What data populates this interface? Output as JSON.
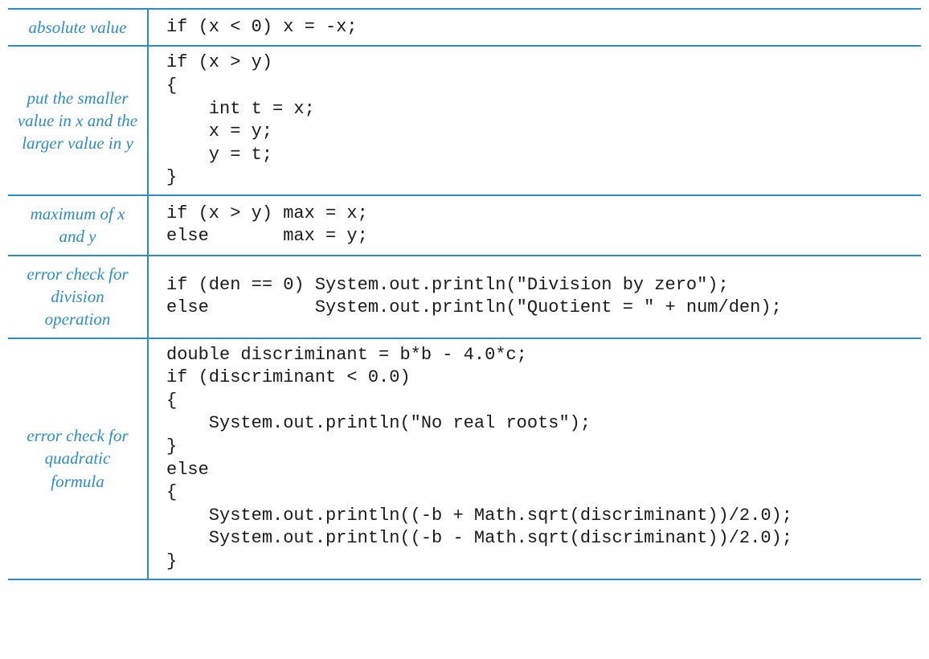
{
  "rows": [
    {
      "label": "absolute value",
      "code": "if (x < 0) x = -x;"
    },
    {
      "label": "put the smaller value in x\nand the larger value in y",
      "code": "if (x > y)\n{\n    int t = x;\n    x = y;\n    y = t;\n}"
    },
    {
      "label": "maximum of\nx and y",
      "code": "if (x > y) max = x;\nelse       max = y;"
    },
    {
      "label": "error check\nfor division\noperation",
      "code": "if (den == 0) System.out.println(\"Division by zero\");\nelse          System.out.println(\"Quotient = \" + num/den);"
    },
    {
      "label": "error check\nfor quadratic\nformula",
      "code": "double discriminant = b*b - 4.0*c;\nif (discriminant < 0.0)\n{\n    System.out.println(\"No real roots\");\n}\nelse\n{\n    System.out.println((-b + Math.sqrt(discriminant))/2.0);\n    System.out.println((-b - Math.sqrt(discriminant))/2.0);\n}"
    }
  ]
}
